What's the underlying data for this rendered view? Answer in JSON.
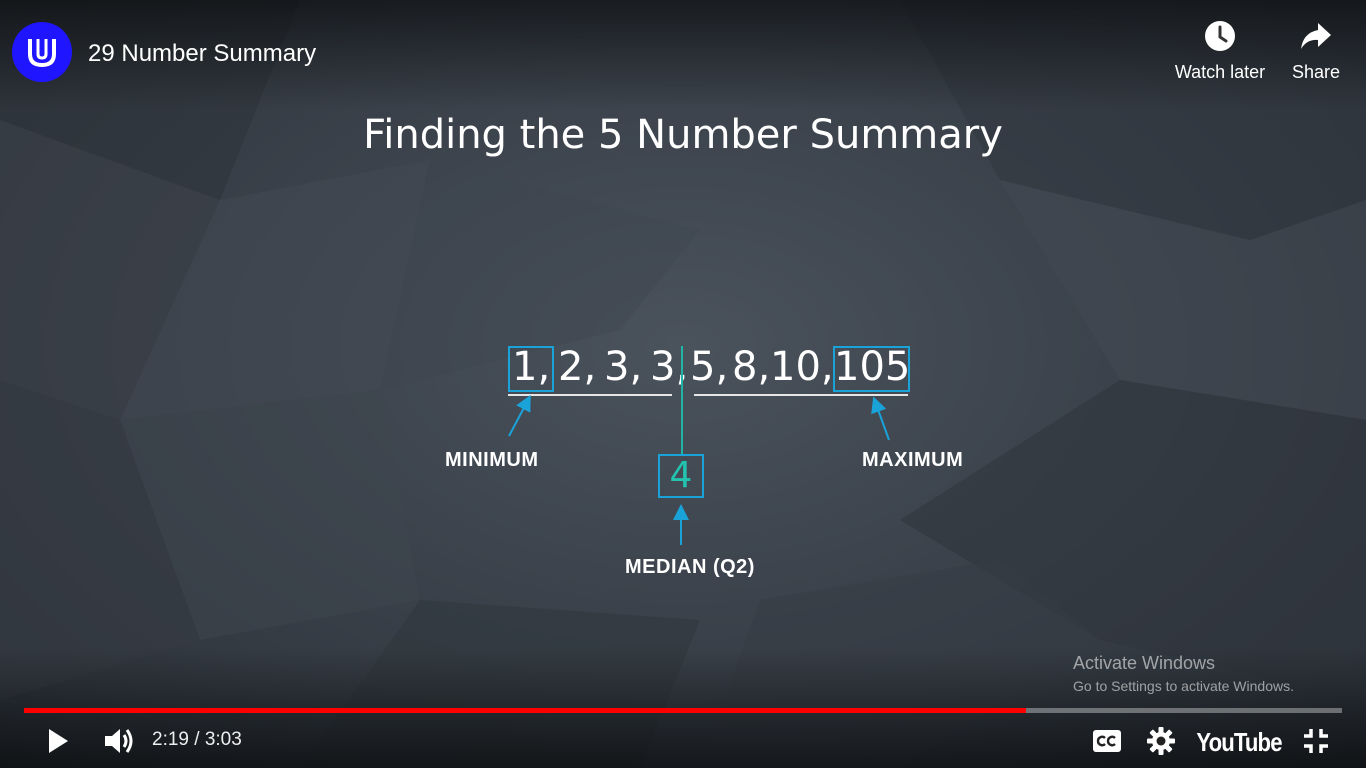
{
  "header": {
    "channel_logo_letter": "U",
    "video_title": "29 Number Summary",
    "watch_later_label": "Watch later",
    "share_label": "Share"
  },
  "slide": {
    "title": "Finding the 5 Number Summary",
    "sequence": [
      "1,",
      "2,",
      "3,",
      "3,",
      "5,",
      "8,",
      "10,",
      "105"
    ],
    "median_value": "4",
    "min_label": "MINIMUM",
    "max_label": "MAXIMUM",
    "median_label": "MEDIAN (Q2)",
    "accent_color": "#1aa3d9",
    "median_color": "#23c3b0"
  },
  "watermark": {
    "line1": "Activate Windows",
    "line2": "Go to Settings to activate Windows."
  },
  "controls": {
    "current_time": "2:19",
    "duration": "3:03",
    "time_display": "2:19 / 3:03",
    "played_fraction": 0.76,
    "youtube_label": "YouTube",
    "progress_color": "#ff0000"
  }
}
